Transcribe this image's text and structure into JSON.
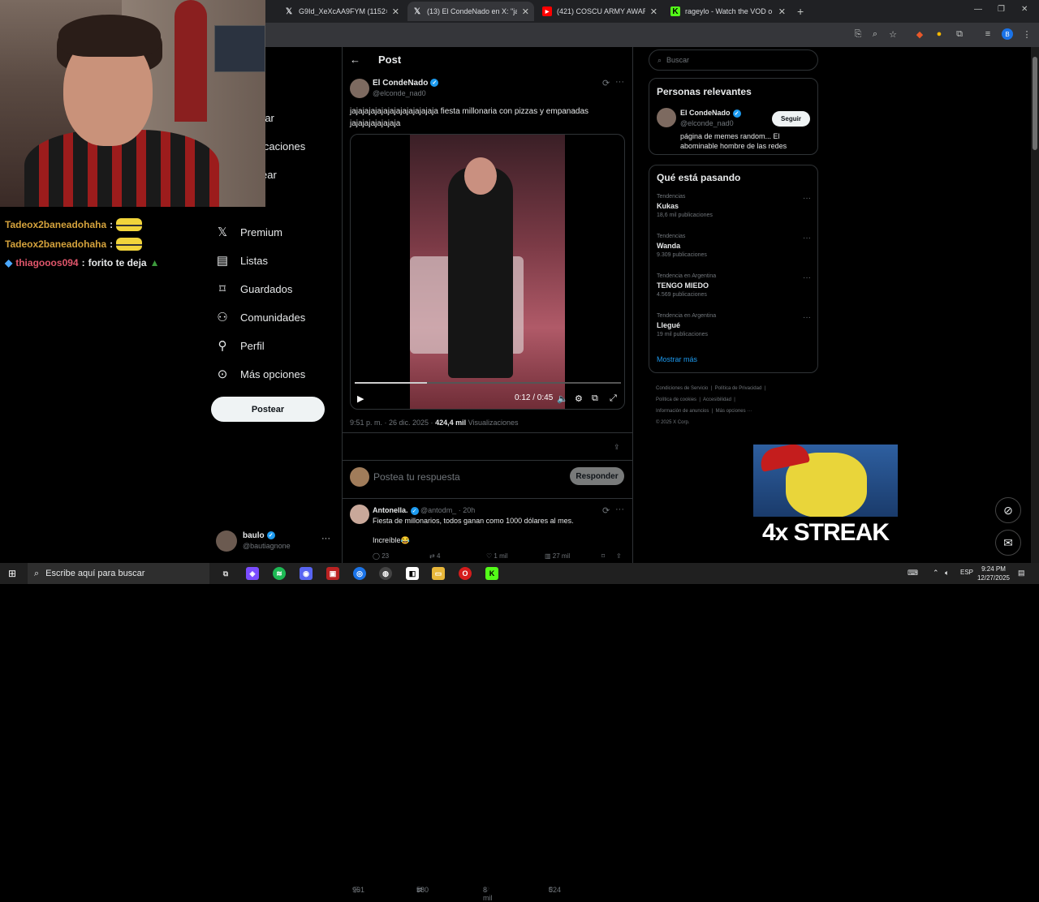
{
  "browser": {
    "tabs": [
      {
        "title": "G9Id_XeXcAA9FYM (1152×204",
        "favicon": "x-logo"
      },
      {
        "title": "(13) El CondeNado en X: \"jajaja",
        "favicon": "x-logo"
      },
      {
        "title": "(421) COSCU ARMY AWARDS 2",
        "favicon": "youtube-icon"
      },
      {
        "title": "rageylo - Watch the VOD o",
        "favicon": "kick-icon"
      }
    ],
    "new_tab": "+",
    "profile_initial": "B"
  },
  "stream_overlay": {
    "chat": [
      {
        "user": "Tadeox2baneadohaha",
        "sep": ":",
        "msg": ""
      },
      {
        "user": "Tadeox2baneadohaha",
        "sep": ":",
        "msg": ""
      },
      {
        "user": "thiagooos094",
        "sep": ":",
        "msg": "forito te deja"
      }
    ],
    "streak": "4x STREAK"
  },
  "nav": {
    "partial_items": [
      "rar",
      "icaciones",
      "ear"
    ],
    "items": [
      {
        "label": "Premium",
        "icon": "x-logo"
      },
      {
        "label": "Listas",
        "icon": "list-icon"
      },
      {
        "label": "Guardados",
        "icon": "bookmark-icon"
      },
      {
        "label": "Comunidades",
        "icon": "communities-icon"
      },
      {
        "label": "Perfil",
        "icon": "person-icon"
      },
      {
        "label": "Más opciones",
        "icon": "more-circle-icon"
      }
    ],
    "post_button": "Postear",
    "account": {
      "name": "baulo",
      "handle": "@bautiagnone"
    }
  },
  "post": {
    "header_title": "Post",
    "author_name": "El CondeNado",
    "author_handle": "@elconde_nad0",
    "text": "jajajajajajajajajajajajajaja fiesta millonaria con pizzas y empanadas jajajajajajajaja",
    "video": {
      "time": "0:12 / 0:45",
      "progress": 0.27
    },
    "timestamp": "9:51 p. m. · 26 dic. 2025 ·",
    "views_count": "424,4 mil",
    "views_label": "Visualizaciones",
    "stats": {
      "replies": "961",
      "reposts": "580",
      "likes": "8 mil",
      "bookmarks": "524"
    },
    "reply_placeholder": "Postea tu respuesta",
    "reply_button": "Responder"
  },
  "reply_post": {
    "author_name": "Antonella.",
    "author_handle": "@antodm_",
    "time": "· 20h",
    "text": "Fiesta de millonarios, todos ganan como 1000 dólares al mes.",
    "text2": "Increíble😂",
    "stats": {
      "replies": "23",
      "reposts": "4",
      "likes": "1 mil",
      "views": "27 mil"
    }
  },
  "sidebar": {
    "search_placeholder": "Buscar",
    "relevant_title": "Personas relevantes",
    "relevant_person": {
      "name": "El CondeNado",
      "handle": "@elconde_nad0",
      "bio": "página de memes random... El abominable hombre de las redes",
      "follow": "Seguir"
    },
    "trends_title": "Qué está pasando",
    "trends": [
      {
        "category": "Tendencias",
        "name": "Kukas",
        "count": "18,6 mil publicaciones"
      },
      {
        "category": "Tendencias",
        "name": "Wanda",
        "count": "9.309 publicaciones"
      },
      {
        "category": "Tendencia en Argentina",
        "name": "TENGO MIEDO",
        "count": "4.569 publicaciones"
      },
      {
        "category": "Tendencia en Argentina",
        "name": "Llegué",
        "count": "19 mil publicaciones"
      }
    ],
    "show_more": "Mostrar más",
    "footer": {
      "terms": "Condiciones de Servicio",
      "privacy": "Política de Privacidad",
      "cookies": "Política de cookies",
      "accessibility": "Accesibilidad",
      "ads": "Información de anuncios",
      "more": "Más opciones ···",
      "copyright": "© 2025 X Corp."
    }
  },
  "taskbar": {
    "search_placeholder": "Escribe aquí para buscar",
    "lang": "ESP",
    "time": "9:24 PM",
    "date": "12/27/2025"
  },
  "colors": {
    "accent": "#1d9bf0",
    "chat_name": "#d4a23c",
    "chat_user2": "#e0566b"
  }
}
